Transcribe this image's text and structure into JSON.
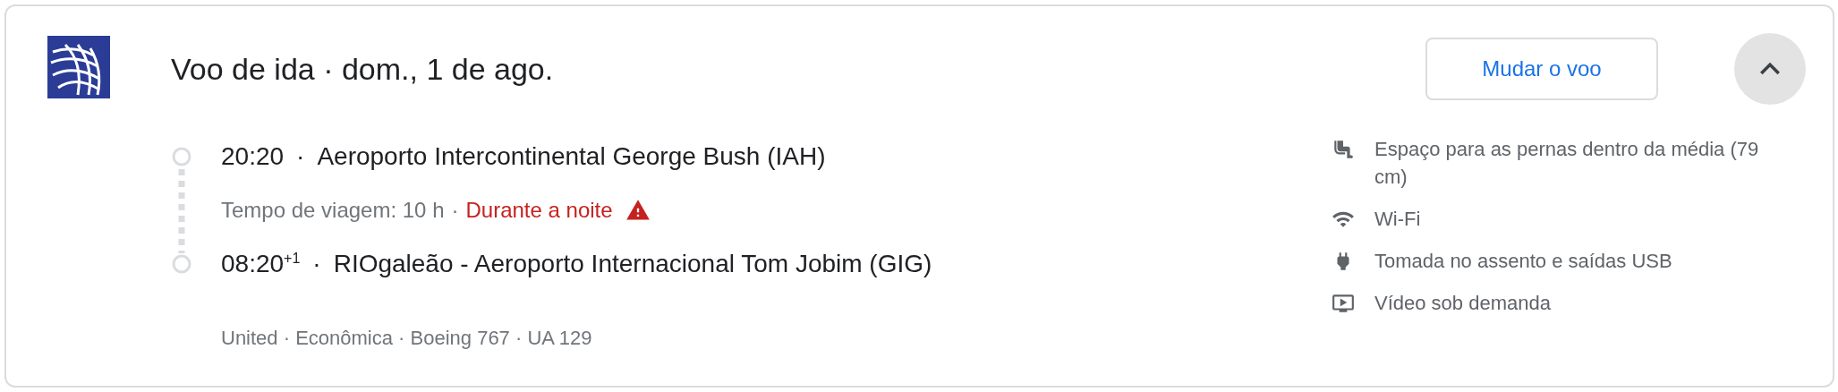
{
  "flight": {
    "title": "Voo de ida · dom., 1 de ago.",
    "change_button": {
      "label": "Mudar o voo"
    },
    "collapse_button": {
      "expanded": true
    },
    "stops": [
      {
        "time": "20:20",
        "separator": "·",
        "place": "Aeroporto Intercontinental George Bush (IAH)"
      },
      {
        "time": "08:20$^{+1}$",
        "separator": "·",
        "place": "RIOgaleão - Aeroporto Internacional Tom Jobim (GIG)"
      }
    ],
    "travel_time": {
      "text": "Tempo de viagem: 10 h",
      "separator": "·",
      "warning": "Durante a noite"
    },
    "details": "United · Econômica · Boeing 767 · UA 129",
    "amenities": [
      {
        "kind": "legroom",
        "text": "Espaço para as pernas dentro da média (79 cm)"
      },
      {
        "kind": "wifi",
        "text": "Wi-Fi"
      },
      {
        "kind": "power",
        "text": "Tomada no assento e saídas USB"
      },
      {
        "kind": "video",
        "text": "Vídeo sob demanda"
      }
    ]
  }
}
